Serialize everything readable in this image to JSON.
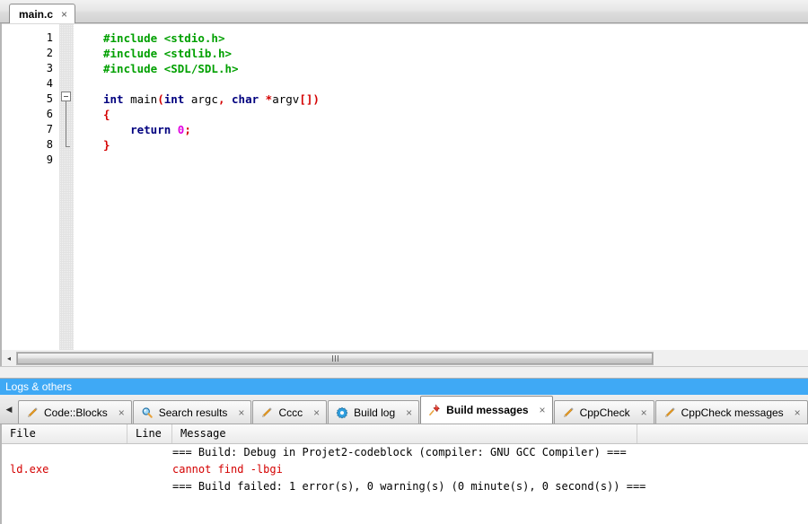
{
  "editor": {
    "tab": {
      "label": "main.c",
      "close_label": "×",
      "icon": "file-tab"
    },
    "line_numbers": [
      "1",
      "2",
      "3",
      "4",
      "5",
      "6",
      "7",
      "8",
      "9"
    ],
    "code_lines": [
      {
        "n": "1",
        "tokens": [
          {
            "t": "#include ",
            "c": "pre"
          },
          {
            "t": "<stdio.h>",
            "c": "pre"
          }
        ]
      },
      {
        "n": "2",
        "tokens": [
          {
            "t": "#include ",
            "c": "pre"
          },
          {
            "t": "<stdlib.h>",
            "c": "pre"
          }
        ]
      },
      {
        "n": "3",
        "tokens": [
          {
            "t": "#include ",
            "c": "pre"
          },
          {
            "t": "<SDL/SDL.h>",
            "c": "pre"
          }
        ]
      },
      {
        "n": "4",
        "tokens": []
      },
      {
        "n": "5",
        "tokens": [
          {
            "t": "int",
            "c": "kw"
          },
          {
            "t": " ",
            "c": "plain"
          },
          {
            "t": "main",
            "c": "id"
          },
          {
            "t": "(",
            "c": "op"
          },
          {
            "t": "int",
            "c": "kw"
          },
          {
            "t": " argc",
            "c": "id"
          },
          {
            "t": ",",
            "c": "op"
          },
          {
            "t": " ",
            "c": "plain"
          },
          {
            "t": "char",
            "c": "kw"
          },
          {
            "t": " ",
            "c": "plain"
          },
          {
            "t": "*",
            "c": "op"
          },
          {
            "t": "argv",
            "c": "id"
          },
          {
            "t": "[])",
            "c": "op"
          }
        ]
      },
      {
        "n": "6",
        "tokens": [
          {
            "t": "{",
            "c": "op"
          }
        ]
      },
      {
        "n": "7",
        "tokens": [
          {
            "t": "    ",
            "c": "plain"
          },
          {
            "t": "return",
            "c": "kw"
          },
          {
            "t": " ",
            "c": "plain"
          },
          {
            "t": "0",
            "c": "num"
          },
          {
            "t": ";",
            "c": "op"
          }
        ]
      },
      {
        "n": "8",
        "tokens": [
          {
            "t": "}",
            "c": "op"
          }
        ]
      },
      {
        "n": "9",
        "tokens": []
      }
    ],
    "fold_marker_line": 6,
    "scrollbar": {
      "left_arrow": "◂",
      "grip": "|||"
    }
  },
  "logs_panel": {
    "title": "Logs & others",
    "scroll_left_arrow": "◀",
    "tabs": [
      {
        "label": "Code::Blocks",
        "icon": "pencil-icon",
        "close": "×",
        "active": false
      },
      {
        "label": "Search results",
        "icon": "magnifier-icon",
        "close": "×",
        "active": false
      },
      {
        "label": "Cccc",
        "icon": "pencil-icon",
        "close": "×",
        "active": false
      },
      {
        "label": "Build log",
        "icon": "gear-icon",
        "close": "×",
        "active": false
      },
      {
        "label": "Build messages",
        "icon": "pushpin-icon",
        "close": "×",
        "active": true
      },
      {
        "label": "CppCheck",
        "icon": "pencil-icon",
        "close": "×",
        "active": false
      },
      {
        "label": "CppCheck messages",
        "icon": "pencil-icon",
        "close": "×",
        "active": false
      }
    ]
  },
  "messages": {
    "columns": [
      "File",
      "Line",
      "Message"
    ],
    "rows": [
      {
        "file": "",
        "line": "",
        "message": "=== Build: Debug in Projet2-codeblock (compiler: GNU GCC Compiler) ===",
        "color": "black"
      },
      {
        "file": "ld.exe",
        "line": "",
        "message": "cannot find -lbgi",
        "color": "red"
      },
      {
        "file": "",
        "line": "",
        "message": "=== Build failed: 1 error(s), 0 warning(s) (0 minute(s), 0 second(s)) ===",
        "color": "black"
      }
    ]
  },
  "colors": {
    "accent_blue": "#3fa9f5",
    "error_red": "#d40000",
    "preprocessor_green": "#00a000",
    "keyword_blue": "#00007f",
    "number_magenta": "#e000e0"
  }
}
